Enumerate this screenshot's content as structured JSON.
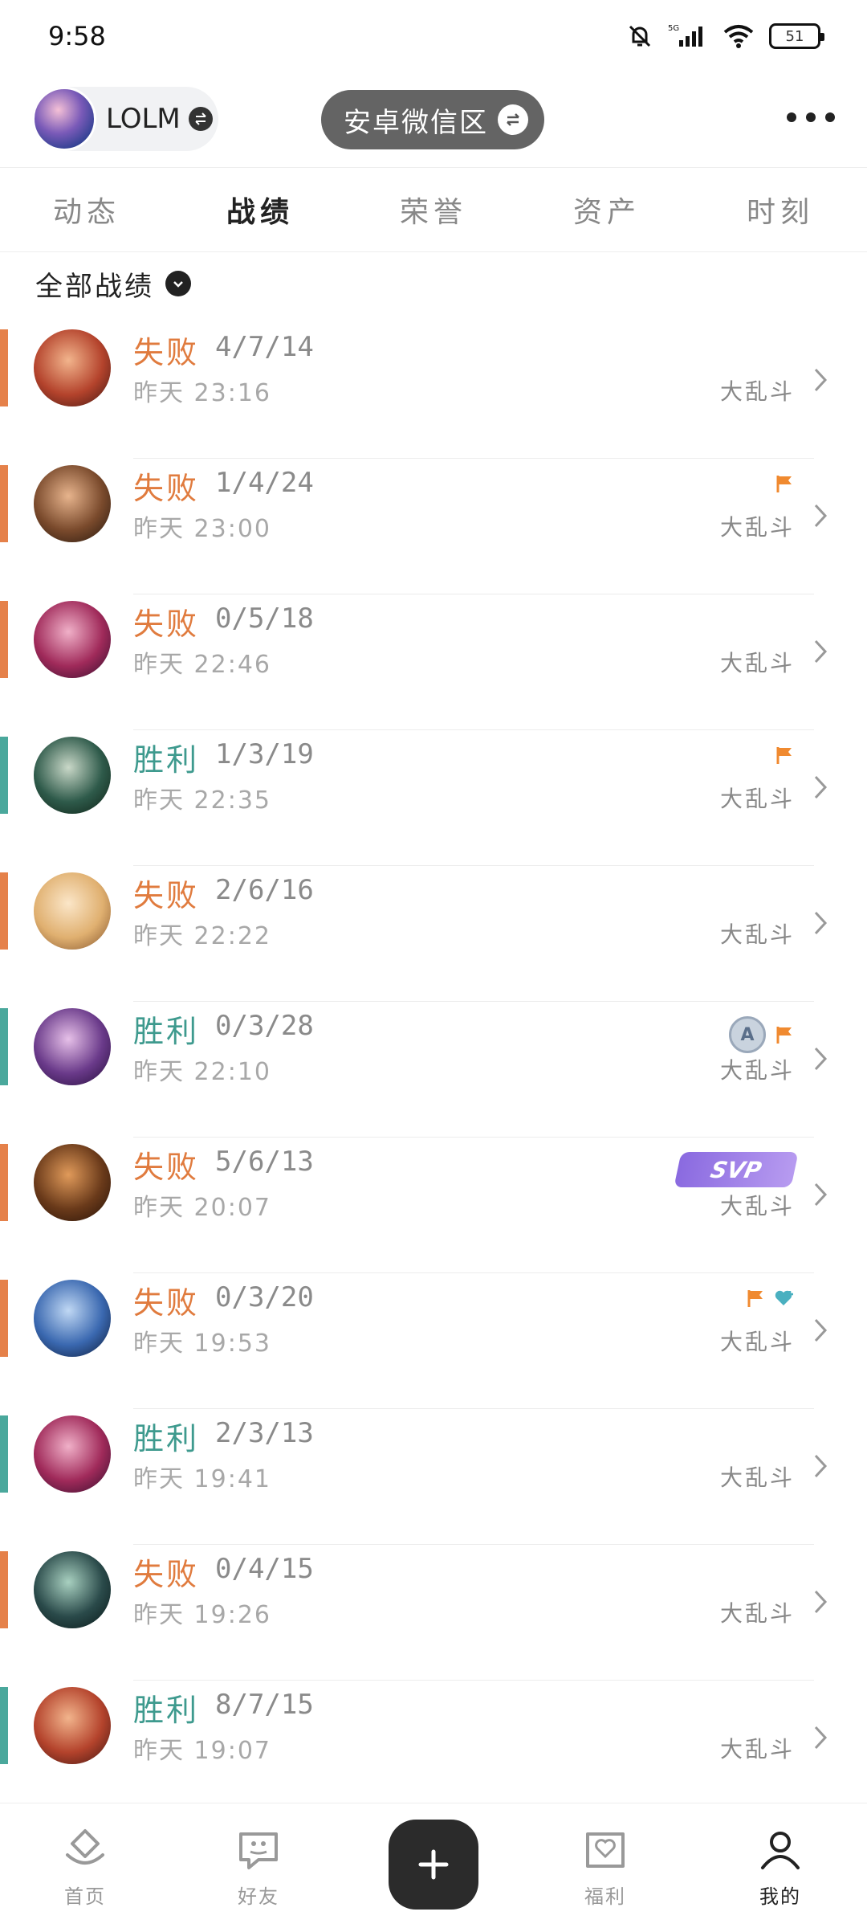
{
  "status_bar": {
    "time": "9:58",
    "network": "5G",
    "battery": "51"
  },
  "header": {
    "account_name": "LOLM",
    "server_name": "安卓微信区"
  },
  "tabs": [
    {
      "label": "动态"
    },
    {
      "label": "战绩"
    },
    {
      "label": "荣誉"
    },
    {
      "label": "资产"
    },
    {
      "label": "时刻"
    }
  ],
  "active_tab": "战绩",
  "filter": {
    "label": "全部战绩"
  },
  "matches": [
    {
      "result": "失败",
      "kda": "4/7/14",
      "time": "昨天 23:16",
      "mode": "大乱斗",
      "badges": []
    },
    {
      "result": "失败",
      "kda": "1/4/24",
      "time": "昨天 23:00",
      "mode": "大乱斗",
      "badges": [
        "flag"
      ]
    },
    {
      "result": "失败",
      "kda": "0/5/18",
      "time": "昨天 22:46",
      "mode": "大乱斗",
      "badges": []
    },
    {
      "result": "胜利",
      "kda": "1/3/19",
      "time": "昨天 22:35",
      "mode": "大乱斗",
      "badges": [
        "flag"
      ]
    },
    {
      "result": "失败",
      "kda": "2/6/16",
      "time": "昨天 22:22",
      "mode": "大乱斗",
      "badges": []
    },
    {
      "result": "胜利",
      "kda": "0/3/28",
      "time": "昨天 22:10",
      "mode": "大乱斗",
      "badges": [
        "a-rank",
        "flag"
      ]
    },
    {
      "result": "失败",
      "kda": "5/6/13",
      "time": "昨天 20:07",
      "mode": "大乱斗",
      "badges": [
        "svp"
      ]
    },
    {
      "result": "失败",
      "kda": "0/3/20",
      "time": "昨天 19:53",
      "mode": "大乱斗",
      "badges": [
        "flag",
        "heart"
      ]
    },
    {
      "result": "胜利",
      "kda": "2/3/13",
      "time": "昨天 19:41",
      "mode": "大乱斗",
      "badges": []
    },
    {
      "result": "失败",
      "kda": "0/4/15",
      "time": "昨天 19:26",
      "mode": "大乱斗",
      "badges": []
    },
    {
      "result": "胜利",
      "kda": "8/7/15",
      "time": "昨天 19:07",
      "mode": "大乱斗",
      "badges": []
    }
  ],
  "badge_labels": {
    "svp": "SVP",
    "a_rank": "A"
  },
  "colors": {
    "lose": "#e07b3e",
    "win": "#3e9a8e"
  },
  "bottom_nav": [
    {
      "label": "首页",
      "icon": "home-icon"
    },
    {
      "label": "好友",
      "icon": "chat-icon"
    },
    {
      "label": "福利",
      "icon": "gift-heart-icon"
    },
    {
      "label": "我的",
      "icon": "profile-icon"
    }
  ]
}
